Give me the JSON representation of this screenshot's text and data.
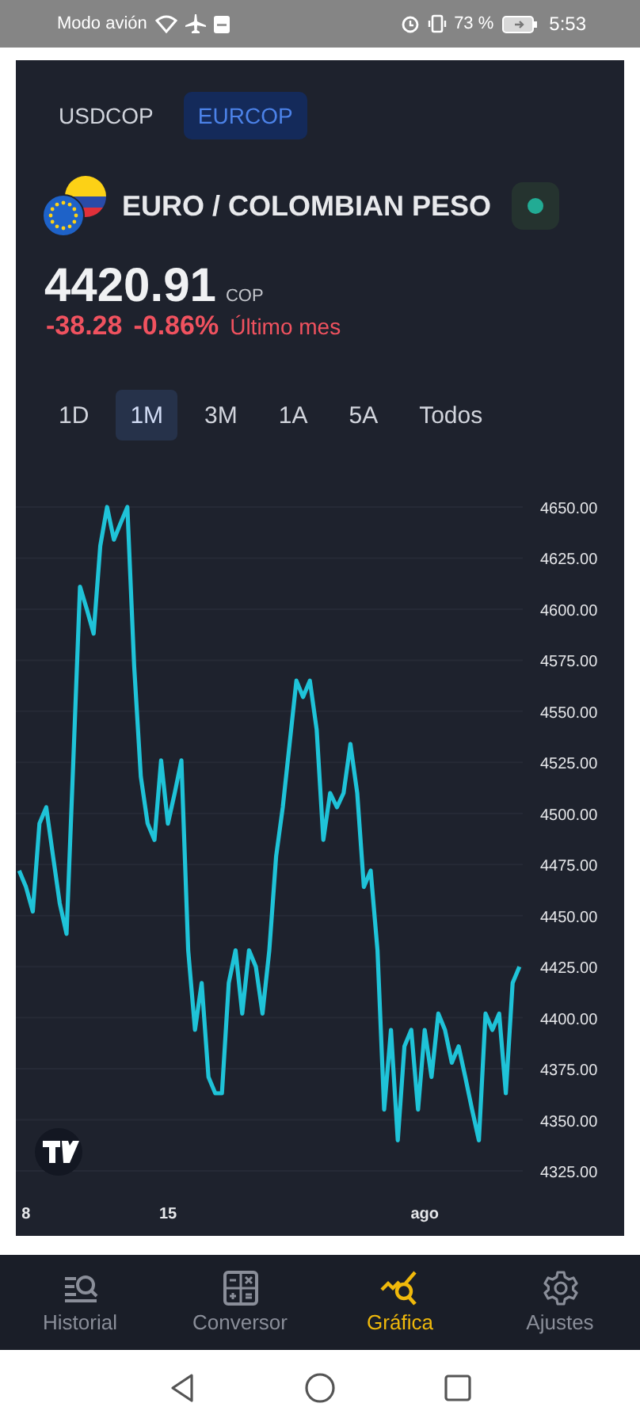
{
  "status_bar": {
    "mode_text": "Modo avión",
    "battery_percent": "73 %",
    "time": "5:53"
  },
  "symbol_tabs": [
    {
      "label": "USDCOP",
      "selected": false
    },
    {
      "label": "EURCOP",
      "selected": true
    }
  ],
  "instrument": {
    "name": "EURO / COLOMBIAN PESO",
    "market_open": true
  },
  "quote": {
    "price": "4420.91",
    "currency": "COP",
    "change": "-38.28",
    "change_percent": "-0.86%",
    "period": "Último mes"
  },
  "range_tabs": [
    {
      "label": "1D",
      "selected": false
    },
    {
      "label": "1M",
      "selected": true
    },
    {
      "label": "3M",
      "selected": false
    },
    {
      "label": "1A",
      "selected": false
    },
    {
      "label": "5A",
      "selected": false
    },
    {
      "label": "Todos",
      "selected": false
    }
  ],
  "chart": {
    "chart_data": {
      "type": "line",
      "grid": true,
      "categories": [
        null,
        "8",
        null,
        null,
        null,
        null,
        null,
        null,
        null,
        null,
        null,
        null,
        null,
        null,
        null,
        null,
        null,
        null,
        null,
        null,
        null,
        null,
        "15",
        null,
        null,
        null,
        null,
        null,
        null,
        null,
        null,
        null,
        null,
        null,
        null,
        null,
        null,
        null,
        null,
        null,
        null,
        null,
        null,
        null,
        null,
        null,
        null,
        null,
        null,
        null,
        null,
        null,
        null,
        null,
        null,
        null,
        null,
        null,
        null,
        null,
        "ago",
        null,
        null,
        null,
        null,
        null,
        null,
        null,
        null,
        null,
        null,
        null,
        null,
        null,
        null
      ],
      "ylim": [
        4325,
        4650
      ],
      "yticks": [
        {
          "value": 4325,
          "label": "4325.00"
        },
        {
          "value": 4350,
          "label": "4350.00"
        },
        {
          "value": 4375,
          "label": "4375.00"
        },
        {
          "value": 4400,
          "label": "4400.00"
        },
        {
          "value": 4425,
          "label": "4425.00"
        },
        {
          "value": 4450,
          "label": "4450.00"
        },
        {
          "value": 4475,
          "label": "4475.00"
        },
        {
          "value": 4500,
          "label": "4500.00"
        },
        {
          "value": 4525,
          "label": "4525.00"
        },
        {
          "value": 4550,
          "label": "4550.00"
        },
        {
          "value": 4575,
          "label": "4575.00"
        },
        {
          "value": 4600,
          "label": "4600.00"
        },
        {
          "value": 4625,
          "label": "4625.00"
        },
        {
          "value": 4650,
          "label": "4650.00"
        }
      ],
      "series": [
        {
          "color": "#1fc3d8",
          "values": [
            4472,
            4464,
            4452,
            4495,
            4503,
            4479,
            4456,
            4441,
            4526,
            4611,
            4600,
            4588,
            4631,
            4650,
            4634,
            4642,
            4650,
            4572,
            4518,
            4495,
            4487,
            4526,
            4495,
            4510,
            4526,
            4433,
            4394,
            4417,
            4371,
            4363,
            4363,
            4417,
            4433,
            4402,
            4433,
            4425,
            4402,
            4433,
            4479,
            4503,
            4534,
            4565,
            4557,
            4565,
            4541,
            4487,
            4510,
            4503,
            4510,
            4534,
            4510,
            4464,
            4472,
            4433,
            4355,
            4394,
            4340,
            4386,
            4394,
            4355,
            4394,
            4371,
            4402,
            4394,
            4378,
            4386,
            4371,
            4355,
            4340,
            4402,
            4394,
            4402,
            4363,
            4417,
            4425
          ]
        }
      ]
    }
  },
  "bottom_nav": [
    {
      "label": "Historial",
      "kind": "history",
      "selected": false
    },
    {
      "label": "Conversor",
      "kind": "converter",
      "selected": false
    },
    {
      "label": "Gráfica",
      "kind": "chart",
      "selected": true
    },
    {
      "label": "Ajustes",
      "kind": "settings",
      "selected": false
    }
  ]
}
